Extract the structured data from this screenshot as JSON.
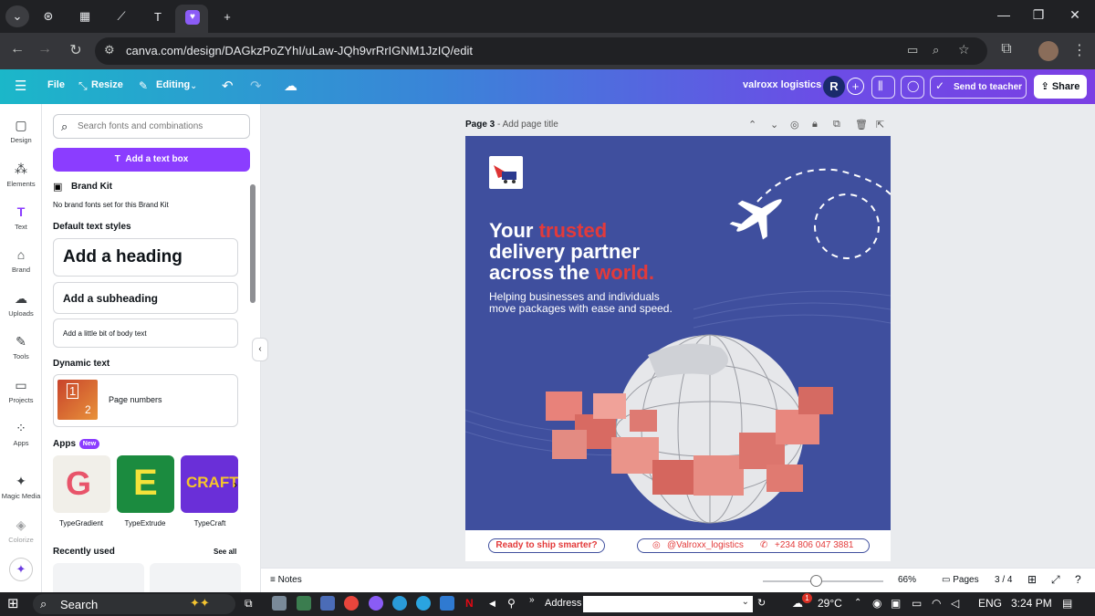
{
  "browser": {
    "url": "canva.com/design/DAGkzPoZYhI/uLaw-JQh9vrRrIGNM1JzIQ/edit",
    "new_tab": "+",
    "controls": {
      "minimize": "—",
      "restore": "❐",
      "close": "✕"
    }
  },
  "canva_header": {
    "file": "File",
    "resize": "Resize",
    "editing": "Editing",
    "title": "valroxx logistics",
    "avatar": "R",
    "send_to_teacher": "Send to teacher",
    "share": "Share"
  },
  "rail": {
    "items": [
      {
        "label": "Design",
        "icon": "▢"
      },
      {
        "label": "Elements",
        "icon": "⁂"
      },
      {
        "label": "Text",
        "icon": "T"
      },
      {
        "label": "Brand",
        "icon": "⌂"
      },
      {
        "label": "Uploads",
        "icon": "☁"
      },
      {
        "label": "Tools",
        "icon": "✎"
      },
      {
        "label": "Projects",
        "icon": "▭"
      },
      {
        "label": "Apps",
        "icon": "⁘"
      },
      {
        "label": "Magic Media",
        "icon": "✦"
      },
      {
        "label": "Colorize",
        "icon": "◈"
      }
    ]
  },
  "panel": {
    "search_placeholder": "Search fonts and combinations",
    "add_text_box": "Add a text box",
    "brand_kit": "Brand Kit",
    "brand_kit_note": "No brand fonts set for this Brand Kit",
    "default_styles": "Default text styles",
    "heading": "Add a heading",
    "subheading": "Add a subheading",
    "body": "Add a little bit of body text",
    "dynamic_text": "Dynamic text",
    "page_numbers": "Page numbers",
    "apps": "Apps",
    "new_badge": "New",
    "app_list": [
      "TypeGradient",
      "TypeExtrude",
      "TypeCraft"
    ],
    "recently_used": "Recently used",
    "see_all": "See all"
  },
  "page": {
    "label": "Page 3",
    "add_title": "Add page title"
  },
  "design": {
    "headline_1a": "Your ",
    "headline_1b": "trusted",
    "headline_2": "delivery partner",
    "headline_3a": "across the ",
    "headline_3b": "world.",
    "sub_1": "Helping businesses and individuals",
    "sub_2": "move packages with ease and speed.",
    "cta": "Ready to ship smarter?",
    "instagram": "@Valroxx_logistics",
    "phone": "+234 806 047 3881",
    "colors": {
      "background": "#3f4f9e",
      "accent": "#e33a3a"
    }
  },
  "statusbar": {
    "notes": "Notes",
    "zoom": "66%",
    "zoom_level": 0.44,
    "pages": "Pages",
    "page_count": "3 / 4"
  },
  "taskbar": {
    "search": "Search",
    "address": "Address",
    "temperature": "29°C",
    "lang": "ENG",
    "time": "3:24 PM",
    "weather_badge": "1"
  }
}
